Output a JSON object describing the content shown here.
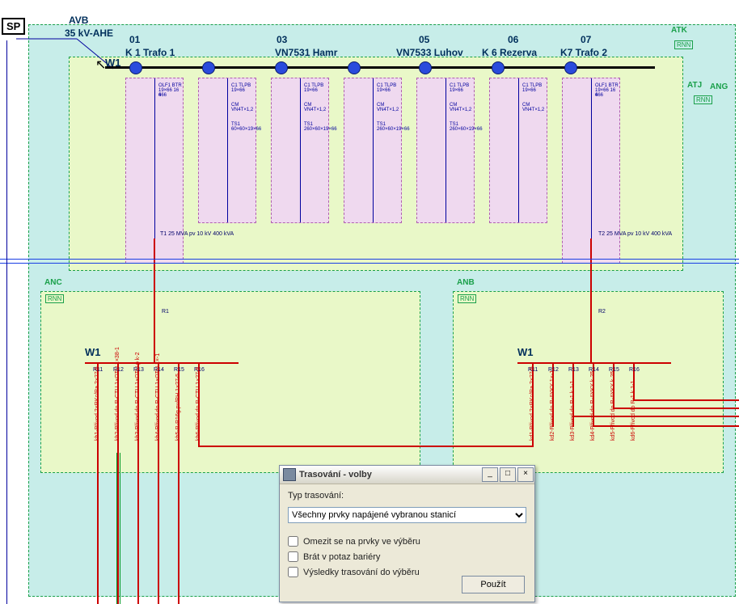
{
  "header": {
    "sp": "SP",
    "avb": "AVB",
    "kv": "35 kV-AHE"
  },
  "regions": {
    "atk": "ATK",
    "atj": "ATJ",
    "ang": "ANG",
    "anc": "ANC",
    "anb": "ANB",
    "rnn": "RNN"
  },
  "bus": {
    "main": "W1",
    "dist": "W1"
  },
  "bays": [
    {
      "num": "01",
      "name": "K 1 Trafo 1"
    },
    {
      "num": "03",
      "name": "VN7531 Hamr"
    },
    {
      "num": "05",
      "name": "VN7533 Luhov"
    },
    {
      "num": "06",
      "name": "K 6 Rezerva"
    },
    {
      "num": "07",
      "name": "K7 Trafo 2"
    }
  ],
  "baySymbols": [
    "OLF1 BTR 19×66 16 6",
    "466",
    "C1 TLPB 19×66",
    "CM VN4T×1,2",
    "TS1 60×60×19×66",
    "TS1 260×60×19×66"
  ],
  "trafo": {
    "t1": "T1  25 MVA pv 10 kV  400 kVA",
    "t2": "T2  25 MVA pv 10 kV  400 kVA"
  },
  "dist": {
    "in1": "R1",
    "in2": "R2",
    "r": [
      "R11",
      "R12",
      "R13",
      "R14",
      "R15",
      "R16"
    ],
    "left": [
      "kb1-Přívod 2×RKc/Ra 2×27-5",
      "kb2-Přívod do R-CTU 1×OTU 1×38-1",
      "kb3-Přívod do R-CTU 1×OTU p k-2",
      "kb4-Přívod do R-CTU 1×OTU 1×-1",
      "kb5-R-R16g pv/RH 1×27-5",
      "kb6-Přívod do R-CTU 1×27-5"
    ],
    "right": [
      "kd1-Přívod 2×RKc/Ra 2×27-5",
      "kd2-Přívod do R-AYKY 1×-1",
      "kd3-Přívod do R-1 k 1-1",
      "kd4-Přívod do R-AYKY k 25",
      "kd5-Přívod do R-AYKY k 25",
      "kd6-Přívod do R-1 k 1-1"
    ]
  },
  "dialog": {
    "title": "Trasování - volby",
    "typeLabel": "Typ trasování:",
    "selected": "Všechny prvky napájené vybranou stanicí",
    "chk1": "Omezit se na prvky ve výběru",
    "chk2": "Brát v potaz bariéry",
    "chk3": "Výsledky trasování do výběru",
    "apply": "Použít"
  }
}
